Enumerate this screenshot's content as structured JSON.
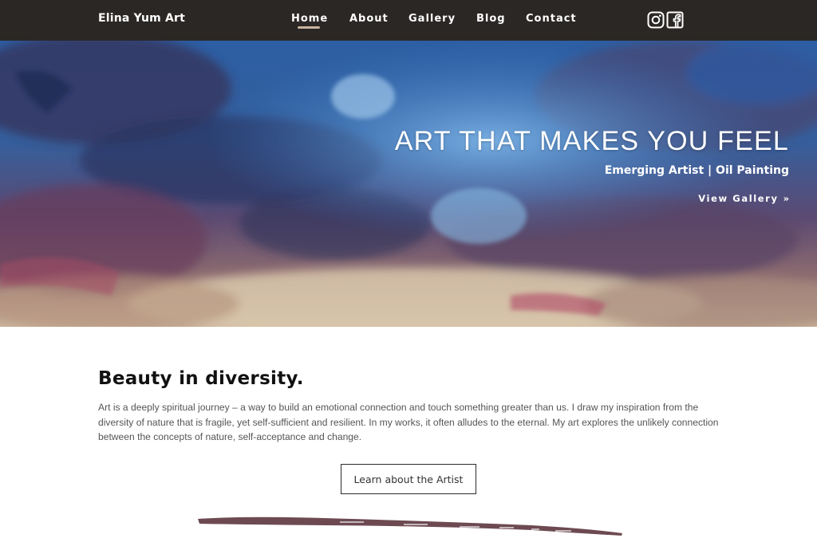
{
  "header": {
    "brand": "Elina Yum Art",
    "nav": {
      "home": "Home",
      "about": "About",
      "gallery": "Gallery",
      "blog": "Blog",
      "contact": "Contact"
    },
    "active_item": "Home",
    "social_icons": [
      "instagram-icon",
      "facebook-icon"
    ]
  },
  "hero": {
    "title": "ART THAT MAKES YOU FEEL",
    "subtitle": "Emerging Artist | Oil Painting",
    "cta_label": "View Gallery",
    "cta_arrow": "»"
  },
  "intro": {
    "heading": "Beauty in diversity.",
    "body": "Art is a deeply spiritual journey – a way to build an emotional connection and touch something greater than us. I draw my inspiration from the diversity of nature that is fragile, yet self-sufficient and resilient. In my works, it often alludes to the eternal. My art explores the unlikely connection between the concepts of nature, self-acceptance and change.",
    "button_label": "Learn about the Artist"
  },
  "colors": {
    "header_bg": "#2b2725",
    "accent_underline": "#c8b49f",
    "brush_stroke": "#6d4a52"
  }
}
